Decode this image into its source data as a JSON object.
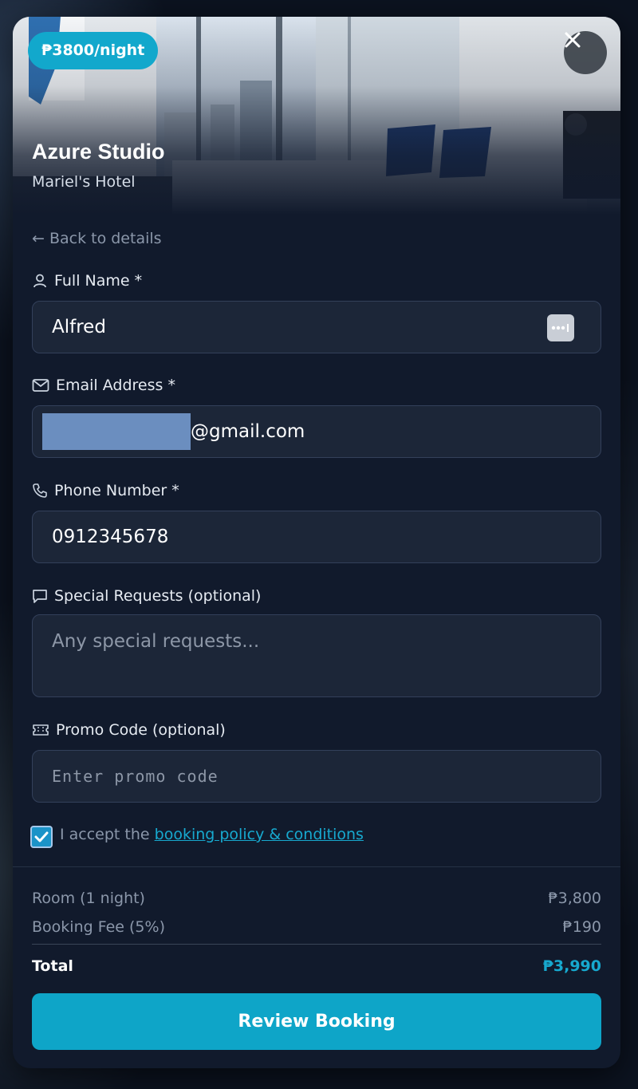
{
  "room": {
    "price_badge": "₱3800/night",
    "title": "Azure Studio",
    "hotel": "Mariel's Hotel"
  },
  "nav": {
    "back_label": "← Back to details",
    "close_icon": "close-icon"
  },
  "form": {
    "full_name": {
      "label": "Full Name *",
      "value": "Alfred",
      "icon": "user-icon"
    },
    "email": {
      "label": "Email Address *",
      "value": "@gmail.com",
      "icon": "mail-icon"
    },
    "phone": {
      "label": "Phone Number *",
      "value": "0912345678",
      "icon": "phone-icon"
    },
    "special_requests": {
      "label": "Special Requests (optional)",
      "placeholder": "Any special requests...",
      "icon": "message-icon"
    },
    "promo": {
      "label": "Promo Code (optional)",
      "placeholder": "Enter promo code",
      "icon": "ticket-icon"
    },
    "consent": {
      "text": "I accept the ",
      "link": "booking policy & conditions",
      "checked": true
    }
  },
  "summary": {
    "room_label": "Room (1 night)",
    "room_amount": "₱3,800",
    "fee_label": "Booking Fee (5%)",
    "fee_amount": "₱190",
    "total_label": "Total",
    "total_amount": "₱3,990"
  },
  "actions": {
    "review_label": "Review Booking"
  },
  "colors": {
    "accent": "#12a8cc",
    "panel": "#111a2c",
    "field": "#1c2638"
  }
}
